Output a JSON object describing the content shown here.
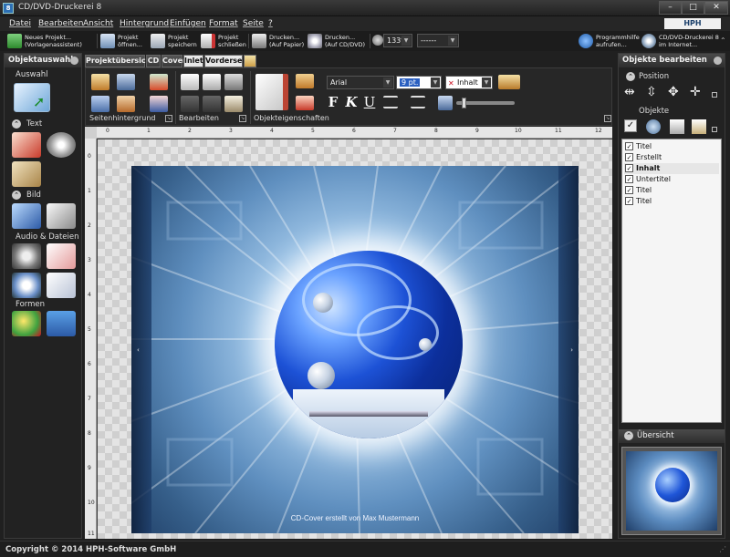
{
  "window": {
    "title": "CD/DVD-Druckerei 8",
    "app_icon_glyph": "8",
    "min_glyph": "–",
    "max_glyph": "□",
    "close_glyph": "✕"
  },
  "menu": {
    "items": [
      "Datei",
      "Bearbeiten",
      "Ansicht",
      "Hintergrund",
      "Einfügen",
      "Format",
      "Seite",
      "?"
    ],
    "brand": "HPH SOFTWARE"
  },
  "toolbar": {
    "new_project": "Neues Projekt...\n(Vorlagenassistent)",
    "open_project": "Projekt\nöffnen...",
    "save_project": "Projekt\nspeichern",
    "close_project": "Projekt\nschließen",
    "print_paper": "Drucken...\n(Auf Papier)",
    "print_cd": "Drucken...\n(Auf CD/DVD)",
    "zoom": "133%",
    "page_select": "------",
    "help": "Programmhilfe\naufrufen...",
    "online": "CD/DVD-Druckerei 8\nim Internet..."
  },
  "left_panel": {
    "title": "Objektauswahl",
    "sections": [
      "Auswahl",
      "Text",
      "Bild",
      "Audio & Dateien",
      "Formen"
    ]
  },
  "tabs": [
    "Projektübersicht",
    "CD",
    "Cover",
    "Inlet",
    "Vorderseite"
  ],
  "ribbon": {
    "groups": [
      "Seitenhintergrund",
      "Bearbeiten",
      "Objekteigenschaften"
    ],
    "font_name": "Arial",
    "font_size": "9 pt.",
    "object_selector": "Inhalt",
    "format_labels": {
      "bold": "F",
      "italic": "K",
      "underline": "U"
    }
  },
  "ruler": {
    "top": [
      "0",
      "1",
      "2",
      "3",
      "4",
      "5",
      "6",
      "7",
      "8",
      "9",
      "10",
      "11",
      "12"
    ],
    "left": [
      "0",
      "1",
      "2",
      "3",
      "4",
      "5",
      "6",
      "7",
      "8",
      "9",
      "10",
      "11"
    ]
  },
  "canvas": {
    "caption": "CD-Cover erstellt von Max Mustermann",
    "marker_left": "‹",
    "marker_right": "›"
  },
  "right_panel": {
    "title": "Objekte bearbeiten",
    "position_label": "Position",
    "objects_label": "Objekte",
    "objects": [
      {
        "label": "Titel",
        "checked": true,
        "selected": false
      },
      {
        "label": "Erstellt",
        "checked": true,
        "selected": false
      },
      {
        "label": "Inhalt",
        "checked": true,
        "selected": true
      },
      {
        "label": "Untertitel",
        "checked": true,
        "selected": false
      },
      {
        "label": "Titel",
        "checked": true,
        "selected": false
      },
      {
        "label": "Titel",
        "checked": true,
        "selected": false
      }
    ],
    "overview_label": "Übersicht"
  },
  "status": {
    "text": "Copyright © 2014 HPH-Software GmbH"
  },
  "colors": {
    "accent_blue": "#2c6fb3",
    "cover_blue": "#365f8a",
    "disc_blue": "#1d52d6",
    "active_tab": "#e8e8e8"
  }
}
